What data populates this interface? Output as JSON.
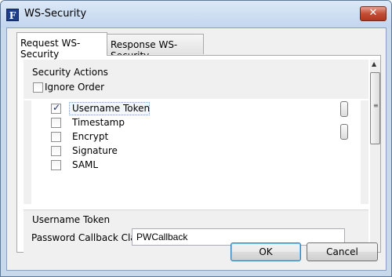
{
  "window": {
    "title": "WS-Security",
    "app_icon_letter": "F",
    "close_glyph": "✕"
  },
  "tabs": [
    {
      "label": "Request WS-Security",
      "active": true
    },
    {
      "label": "Response WS-Security",
      "active": false
    }
  ],
  "security_actions": {
    "heading": "Security Actions",
    "ignore_order": {
      "label": "Ignore Order",
      "checked": false
    },
    "items": [
      {
        "label": "Username Token",
        "checked": true
      },
      {
        "label": "Timestamp",
        "checked": false
      },
      {
        "label": "Encrypt",
        "checked": false
      },
      {
        "label": "Signature",
        "checked": false
      },
      {
        "label": "SAML",
        "checked": false
      }
    ]
  },
  "username_token": {
    "heading": "Username Token",
    "password_callback_label": "Password Callback Class",
    "password_callback_value": "PWCallback"
  },
  "buttons": {
    "ok": "OK",
    "cancel": "Cancel"
  },
  "icons": {
    "app": "app-icon",
    "close": "close-icon",
    "scroll_up": "▲",
    "scroll_down": "▼",
    "grip": "≡"
  },
  "colors": {
    "titlebar": "#c3d6ee",
    "close_button": "#c24d35",
    "default_button_border": "#3c7fb1"
  }
}
